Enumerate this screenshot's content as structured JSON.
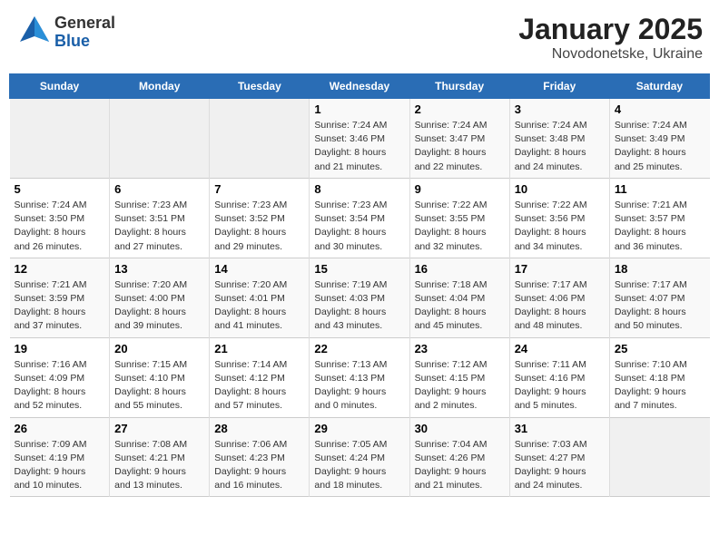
{
  "header": {
    "logo_general": "General",
    "logo_blue": "Blue",
    "title": "January 2025",
    "subtitle": "Novodonetske, Ukraine"
  },
  "days_of_week": [
    "Sunday",
    "Monday",
    "Tuesday",
    "Wednesday",
    "Thursday",
    "Friday",
    "Saturday"
  ],
  "weeks": [
    [
      {
        "day": "",
        "info": ""
      },
      {
        "day": "",
        "info": ""
      },
      {
        "day": "",
        "info": ""
      },
      {
        "day": "1",
        "info": "Sunrise: 7:24 AM\nSunset: 3:46 PM\nDaylight: 8 hours\nand 21 minutes."
      },
      {
        "day": "2",
        "info": "Sunrise: 7:24 AM\nSunset: 3:47 PM\nDaylight: 8 hours\nand 22 minutes."
      },
      {
        "day": "3",
        "info": "Sunrise: 7:24 AM\nSunset: 3:48 PM\nDaylight: 8 hours\nand 24 minutes."
      },
      {
        "day": "4",
        "info": "Sunrise: 7:24 AM\nSunset: 3:49 PM\nDaylight: 8 hours\nand 25 minutes."
      }
    ],
    [
      {
        "day": "5",
        "info": "Sunrise: 7:24 AM\nSunset: 3:50 PM\nDaylight: 8 hours\nand 26 minutes."
      },
      {
        "day": "6",
        "info": "Sunrise: 7:23 AM\nSunset: 3:51 PM\nDaylight: 8 hours\nand 27 minutes."
      },
      {
        "day": "7",
        "info": "Sunrise: 7:23 AM\nSunset: 3:52 PM\nDaylight: 8 hours\nand 29 minutes."
      },
      {
        "day": "8",
        "info": "Sunrise: 7:23 AM\nSunset: 3:54 PM\nDaylight: 8 hours\nand 30 minutes."
      },
      {
        "day": "9",
        "info": "Sunrise: 7:22 AM\nSunset: 3:55 PM\nDaylight: 8 hours\nand 32 minutes."
      },
      {
        "day": "10",
        "info": "Sunrise: 7:22 AM\nSunset: 3:56 PM\nDaylight: 8 hours\nand 34 minutes."
      },
      {
        "day": "11",
        "info": "Sunrise: 7:21 AM\nSunset: 3:57 PM\nDaylight: 8 hours\nand 36 minutes."
      }
    ],
    [
      {
        "day": "12",
        "info": "Sunrise: 7:21 AM\nSunset: 3:59 PM\nDaylight: 8 hours\nand 37 minutes."
      },
      {
        "day": "13",
        "info": "Sunrise: 7:20 AM\nSunset: 4:00 PM\nDaylight: 8 hours\nand 39 minutes."
      },
      {
        "day": "14",
        "info": "Sunrise: 7:20 AM\nSunset: 4:01 PM\nDaylight: 8 hours\nand 41 minutes."
      },
      {
        "day": "15",
        "info": "Sunrise: 7:19 AM\nSunset: 4:03 PM\nDaylight: 8 hours\nand 43 minutes."
      },
      {
        "day": "16",
        "info": "Sunrise: 7:18 AM\nSunset: 4:04 PM\nDaylight: 8 hours\nand 45 minutes."
      },
      {
        "day": "17",
        "info": "Sunrise: 7:17 AM\nSunset: 4:06 PM\nDaylight: 8 hours\nand 48 minutes."
      },
      {
        "day": "18",
        "info": "Sunrise: 7:17 AM\nSunset: 4:07 PM\nDaylight: 8 hours\nand 50 minutes."
      }
    ],
    [
      {
        "day": "19",
        "info": "Sunrise: 7:16 AM\nSunset: 4:09 PM\nDaylight: 8 hours\nand 52 minutes."
      },
      {
        "day": "20",
        "info": "Sunrise: 7:15 AM\nSunset: 4:10 PM\nDaylight: 8 hours\nand 55 minutes."
      },
      {
        "day": "21",
        "info": "Sunrise: 7:14 AM\nSunset: 4:12 PM\nDaylight: 8 hours\nand 57 minutes."
      },
      {
        "day": "22",
        "info": "Sunrise: 7:13 AM\nSunset: 4:13 PM\nDaylight: 9 hours\nand 0 minutes."
      },
      {
        "day": "23",
        "info": "Sunrise: 7:12 AM\nSunset: 4:15 PM\nDaylight: 9 hours\nand 2 minutes."
      },
      {
        "day": "24",
        "info": "Sunrise: 7:11 AM\nSunset: 4:16 PM\nDaylight: 9 hours\nand 5 minutes."
      },
      {
        "day": "25",
        "info": "Sunrise: 7:10 AM\nSunset: 4:18 PM\nDaylight: 9 hours\nand 7 minutes."
      }
    ],
    [
      {
        "day": "26",
        "info": "Sunrise: 7:09 AM\nSunset: 4:19 PM\nDaylight: 9 hours\nand 10 minutes."
      },
      {
        "day": "27",
        "info": "Sunrise: 7:08 AM\nSunset: 4:21 PM\nDaylight: 9 hours\nand 13 minutes."
      },
      {
        "day": "28",
        "info": "Sunrise: 7:06 AM\nSunset: 4:23 PM\nDaylight: 9 hours\nand 16 minutes."
      },
      {
        "day": "29",
        "info": "Sunrise: 7:05 AM\nSunset: 4:24 PM\nDaylight: 9 hours\nand 18 minutes."
      },
      {
        "day": "30",
        "info": "Sunrise: 7:04 AM\nSunset: 4:26 PM\nDaylight: 9 hours\nand 21 minutes."
      },
      {
        "day": "31",
        "info": "Sunrise: 7:03 AM\nSunset: 4:27 PM\nDaylight: 9 hours\nand 24 minutes."
      },
      {
        "day": "",
        "info": ""
      }
    ]
  ]
}
